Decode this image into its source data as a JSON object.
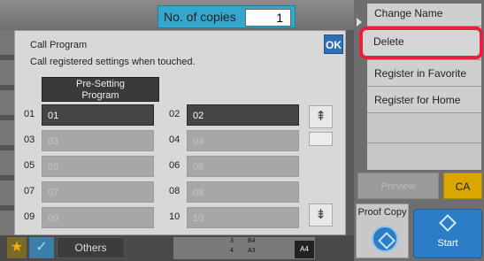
{
  "copies": {
    "label": "No. of copies",
    "value": "1"
  },
  "actions": {
    "change_name": "Change Name",
    "delete": "Delete",
    "register_favorite": "Register in Favorite",
    "register_home": "Register for Home"
  },
  "right": {
    "preview": "Preview",
    "ca": "CA",
    "proof_copy": "Proof Copy",
    "start": "Start"
  },
  "dialog": {
    "title": "Call Program",
    "subtitle": "Call registered settings when touched.",
    "ok": "OK",
    "preset_line1": "Pre-Setting",
    "preset_line2": "Program",
    "programs": [
      {
        "num": "01",
        "label": "01",
        "active": true
      },
      {
        "num": "02",
        "label": "02",
        "active": true
      },
      {
        "num": "03",
        "label": "03",
        "active": false
      },
      {
        "num": "04",
        "label": "04",
        "active": false
      },
      {
        "num": "05",
        "label": "05",
        "active": false
      },
      {
        "num": "06",
        "label": "06",
        "active": false
      },
      {
        "num": "07",
        "label": "07",
        "active": false
      },
      {
        "num": "08",
        "label": "08",
        "active": false
      },
      {
        "num": "09",
        "label": "09",
        "active": false
      },
      {
        "num": "10",
        "label": "10",
        "active": false
      }
    ]
  },
  "bottom": {
    "star_icon": "star-icon",
    "check_icon": "checkmark-icon",
    "others": "Others",
    "paper": {
      "tray3": "3",
      "tray4": "4",
      "size_b4": "B4",
      "size_a3": "A3",
      "selected": "A4"
    }
  },
  "colors": {
    "accent": "#2e6fb5",
    "ca": "#d9a700",
    "highlight": "#e8203a"
  }
}
